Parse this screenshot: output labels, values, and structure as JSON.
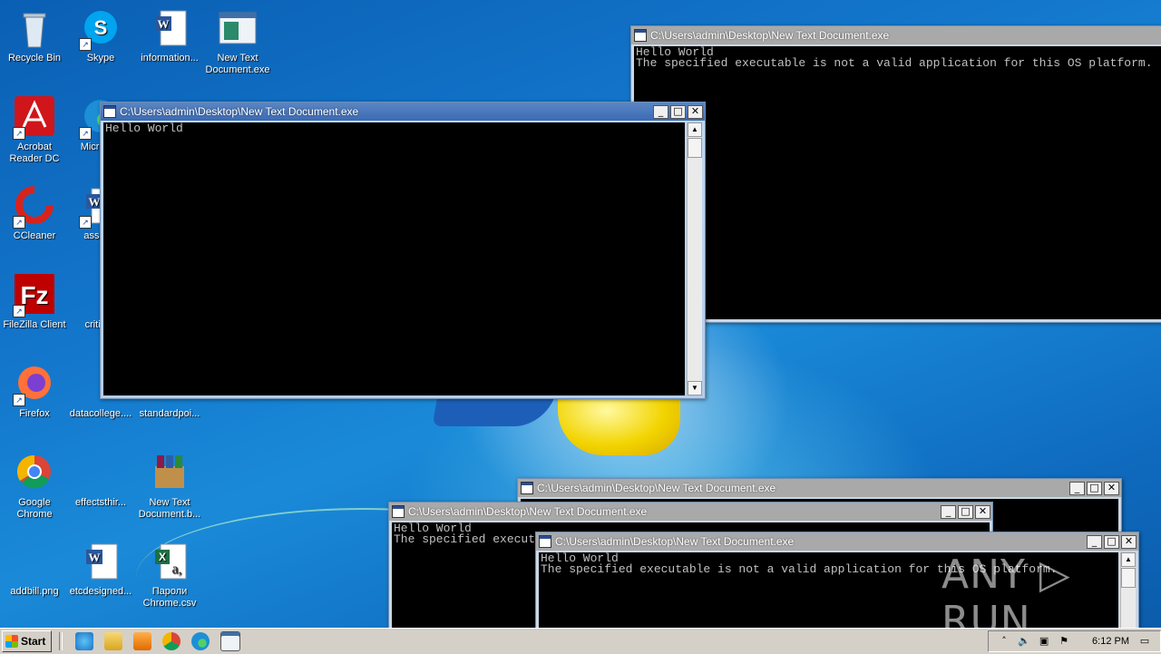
{
  "desktop_icons": [
    {
      "label": "Recycle Bin",
      "icon": "recycle-bin-icon"
    },
    {
      "label": "Skype",
      "icon": "skype-icon"
    },
    {
      "label": "information...",
      "icon": "word-doc-icon"
    },
    {
      "label": "New Text Document.exe",
      "icon": "console-app-icon"
    },
    {
      "label": "Acrobat Reader DC",
      "icon": "acrobat-icon"
    },
    {
      "label": "Microsoft",
      "icon": "edge-icon"
    },
    {
      "label": "CCleaner",
      "icon": "ccleaner-icon"
    },
    {
      "label": "associa",
      "icon": "word-doc-icon"
    },
    {
      "label": "FileZilla Client",
      "icon": "filezilla-icon"
    },
    {
      "label": "criticalr",
      "icon": "blank-file-icon"
    },
    {
      "label": "Firefox",
      "icon": "firefox-icon"
    },
    {
      "label": "datacollege....",
      "icon": "blank-file-icon"
    },
    {
      "label": "standardpoi...",
      "icon": "blank-file-icon"
    },
    {
      "label": "Google Chrome",
      "icon": "chrome-icon"
    },
    {
      "label": "effectsthir...",
      "icon": "blank-file-icon"
    },
    {
      "label": "New Text Document.b...",
      "icon": "winrar-icon"
    },
    {
      "label": "addbill.png",
      "icon": "image-file-icon"
    },
    {
      "label": "etcdesigned...",
      "icon": "word-doc-icon"
    },
    {
      "label": "Пароли Chrome.csv",
      "icon": "excel-csv-icon"
    }
  ],
  "windows": [
    {
      "title": "C:\\Users\\admin\\Desktop\\New Text Document.exe",
      "lines": "Hello World\nThe specified executable is not a valid application for this OS platform."
    },
    {
      "title": "C:\\Users\\admin\\Desktop\\New Text Document.exe",
      "lines": "Hello World"
    },
    {
      "title": "C:\\Users\\admin\\Desktop\\New Text Document.exe",
      "lines": ""
    },
    {
      "title": "C:\\Users\\admin\\Desktop\\New Text Document.exe",
      "lines": "Hello World\nThe specified execut"
    },
    {
      "title": "C:\\Users\\admin\\Desktop\\New Text Document.exe",
      "lines": "Hello World\nThe specified executable is not a valid application for this OS platform."
    }
  ],
  "window_buttons": {
    "minimize": "_",
    "maximize": "□",
    "close": "✕"
  },
  "taskbar": {
    "start_label": "Start",
    "quick_launch": [
      "ie-icon",
      "explorer-icon",
      "media-player-icon",
      "chrome-icon",
      "edge-icon",
      "console-app-icon"
    ],
    "tray_icons": [
      "show-hidden-icon",
      "volume-icon",
      "network-icon",
      "action-center-flag-icon"
    ],
    "clock": "6:12 PM"
  },
  "watermark": "ANY ▷ RUN"
}
